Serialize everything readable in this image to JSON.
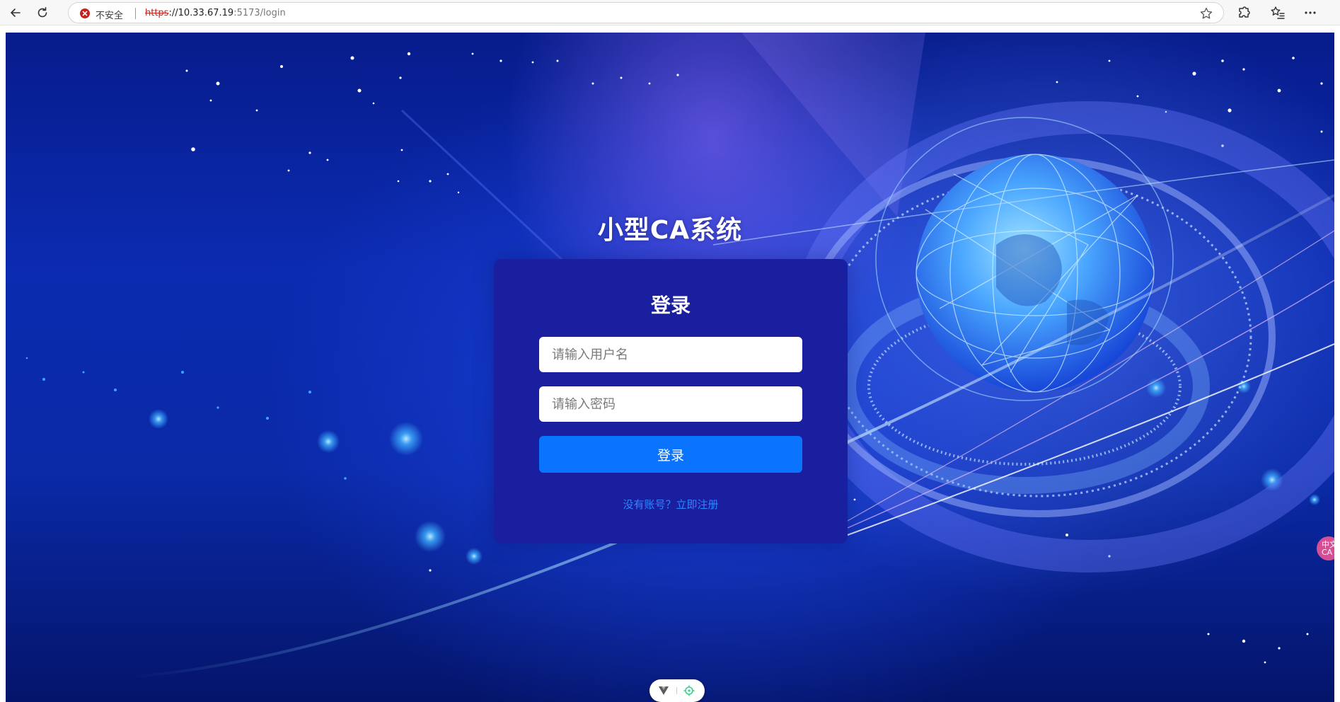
{
  "browser": {
    "security_label": "不安全",
    "url_scheme": "https",
    "url_host": "://10.33.67.19",
    "url_path": ":5173/login",
    "icons": {
      "back": "back-arrow-icon",
      "reload": "reload-icon",
      "not_secure": "not-secure-icon",
      "favorite": "star-icon",
      "extensions": "extensions-icon",
      "favorites_list": "favorites-list-icon",
      "more": "more-icon"
    }
  },
  "page": {
    "title": "小型CA系统"
  },
  "login": {
    "heading": "登录",
    "username_placeholder": "请输入用户名",
    "password_placeholder": "请输入密码",
    "submit_label": "登录",
    "register_link": "没有账号？立即注册"
  },
  "overlay": {
    "side_badge_text": "中文CA",
    "devtools_icons": [
      "vue-devtools-icon",
      "inspector-target-icon"
    ]
  },
  "colors": {
    "card_background": "#1a1fa0",
    "button_primary": "#0a74ff",
    "link": "#2f86ff",
    "background_blue": "#0b2bb0"
  }
}
